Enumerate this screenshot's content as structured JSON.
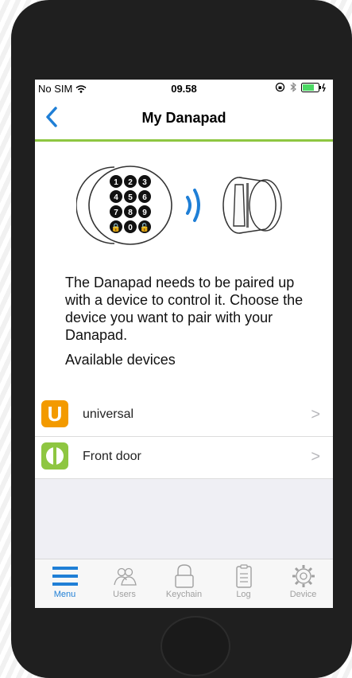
{
  "status": {
    "carrier": "No SIM",
    "time": "09.58"
  },
  "nav": {
    "title": "My Danapad"
  },
  "description": "The Danapad needs to be paired up with a device to control it. Choose the device you want to pair with your Danapad.",
  "available_label": "Available devices",
  "devices": [
    {
      "letter": "U",
      "name": "universal",
      "color": "#f39a00"
    },
    {
      "letter": "⏻",
      "name": "Front door",
      "color": "#8ec641"
    }
  ],
  "keypad_digits": [
    "1",
    "2",
    "3",
    "4",
    "5",
    "6",
    "7",
    "8",
    "9",
    "🔒",
    "0",
    "🔓"
  ],
  "tabs": [
    {
      "label": "Menu"
    },
    {
      "label": "Users"
    },
    {
      "label": "Keychain"
    },
    {
      "label": "Log"
    },
    {
      "label": "Device"
    }
  ],
  "colors": {
    "accent": "#1f7fd6",
    "brand_green": "#8ec641",
    "orange": "#f39a00"
  }
}
